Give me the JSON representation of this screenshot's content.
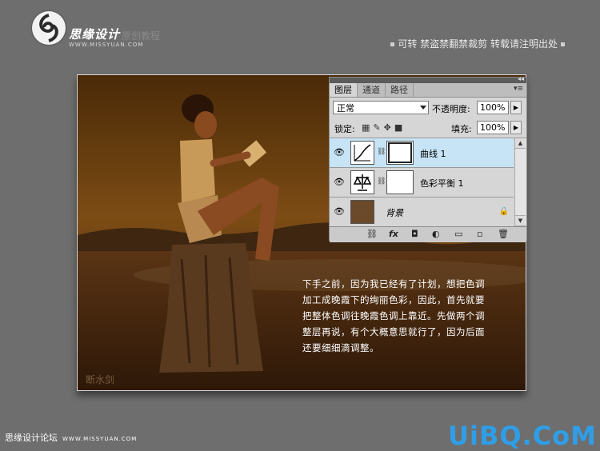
{
  "header": {
    "brand": "思缘设计",
    "subtitle": "原创教程",
    "url": "WWW.MISSYUAN.COM",
    "notice": "可转  禁盗禁翻禁裁剪  转载请注明出处"
  },
  "photo": {
    "caption_lines": [
      "下手之前，因为我已经有了计划，想把色调",
      "加工成晚霞下的绚丽色彩，因此，首先就要",
      "把整体色调往晚霞色调上靠近。先做两个调",
      "整层再说，有个大概意思就行了，因为后面",
      "还要细细滴调整。"
    ],
    "watermark": "断水剑"
  },
  "layers_panel": {
    "tabs": [
      "图层",
      "通道",
      "路径"
    ],
    "blend_mode": "正常",
    "opacity_label": "不透明度:",
    "opacity_value": "100%",
    "lock_label": "锁定:",
    "fill_label": "填充:",
    "fill_value": "100%",
    "layers": [
      {
        "name": "曲线 1",
        "type": "curves",
        "selected": true
      },
      {
        "name": "色彩平衡 1",
        "type": "color-balance",
        "selected": false
      },
      {
        "name": "背景",
        "type": "background",
        "selected": false
      }
    ],
    "bottom_icons": [
      "link-icon",
      "fx-icon",
      "mask-icon",
      "adjustment-icon",
      "folder-icon",
      "new-layer-icon",
      "trash-icon"
    ]
  },
  "footer": {
    "left": "思缘设计论坛",
    "left_url": "WWW.MISSYUAN.COM",
    "right": "UiBQ.CoM"
  },
  "colors": {
    "background": "#6e6e6e",
    "accent_blue": "#2f9ee8",
    "selected_layer": "#c6e4f5"
  }
}
